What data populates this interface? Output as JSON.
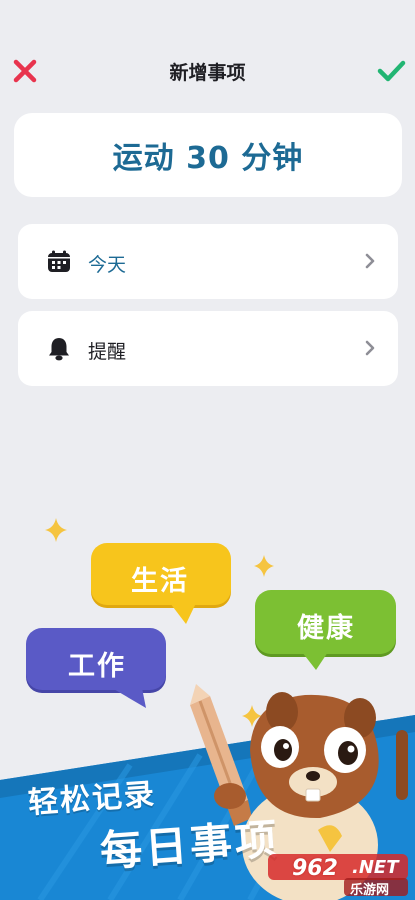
{
  "header": {
    "title": "新增事项",
    "close_icon": "close-x-icon",
    "confirm_icon": "check-icon",
    "close_color": "#e8344e",
    "confirm_color": "#22b573"
  },
  "task": {
    "title": "运动 30 分钟"
  },
  "rows": [
    {
      "icon": "calendar-icon",
      "label": "今天",
      "accent": "#1d6a94"
    },
    {
      "icon": "bell-icon",
      "label": "提醒",
      "accent": "#1f1f24"
    }
  ],
  "illustration": {
    "bubbles": [
      {
        "text": "生活",
        "color": "#f7c51c"
      },
      {
        "text": "健康",
        "color": "#7cc033"
      },
      {
        "text": "工作",
        "color": "#5a5ac6"
      }
    ],
    "slogan_line1": "轻松记录",
    "slogan_line2": "每日事项",
    "banner_color": "#1987d4"
  },
  "watermark": {
    "number": "962",
    "suffix": ".NET",
    "site": "乐游网"
  }
}
